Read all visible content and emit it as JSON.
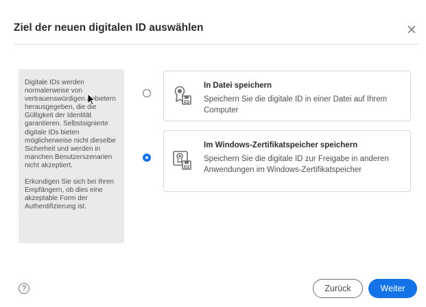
{
  "dialog": {
    "title": "Ziel der neuen digitalen ID auswählen",
    "close_icon": "close-icon"
  },
  "info_panel": {
    "paragraph1": "Digitale IDs werden normalerweise von vertrauenswürdigen Anbietern herausgegeben, die die Gültigkeit der Identität garantieren. Selbstsignierte digitale IDs bieten möglicherweise nicht dieselbe Sicherheit und werden in manchen Benutzerszenarien nicht akzeptiert.",
    "paragraph2": "Erkundigen Sie sich bei Ihren Empfängern, ob dies eine akzeptable Form der Authentifizierung ist."
  },
  "options": [
    {
      "title": "In Datei speichern",
      "description": "Speichern Sie die digitale ID in einer Datei auf Ihrem Computer",
      "selected": false,
      "icon": "certificate-file-icon"
    },
    {
      "title": "Im Windows-Zertifikatspeicher speichern",
      "description": "Speichern Sie die digitale ID zur Freigabe in anderen Anwendungen im Windows-Zertifikatspeicher",
      "selected": true,
      "icon": "certificate-store-icon"
    }
  ],
  "footer": {
    "help_label": "?",
    "back_label": "Zurück",
    "next_label": "Weiter"
  },
  "colors": {
    "accent": "#1473e6",
    "panel_bg": "#eaeaea",
    "border": "#d6d6d6"
  }
}
